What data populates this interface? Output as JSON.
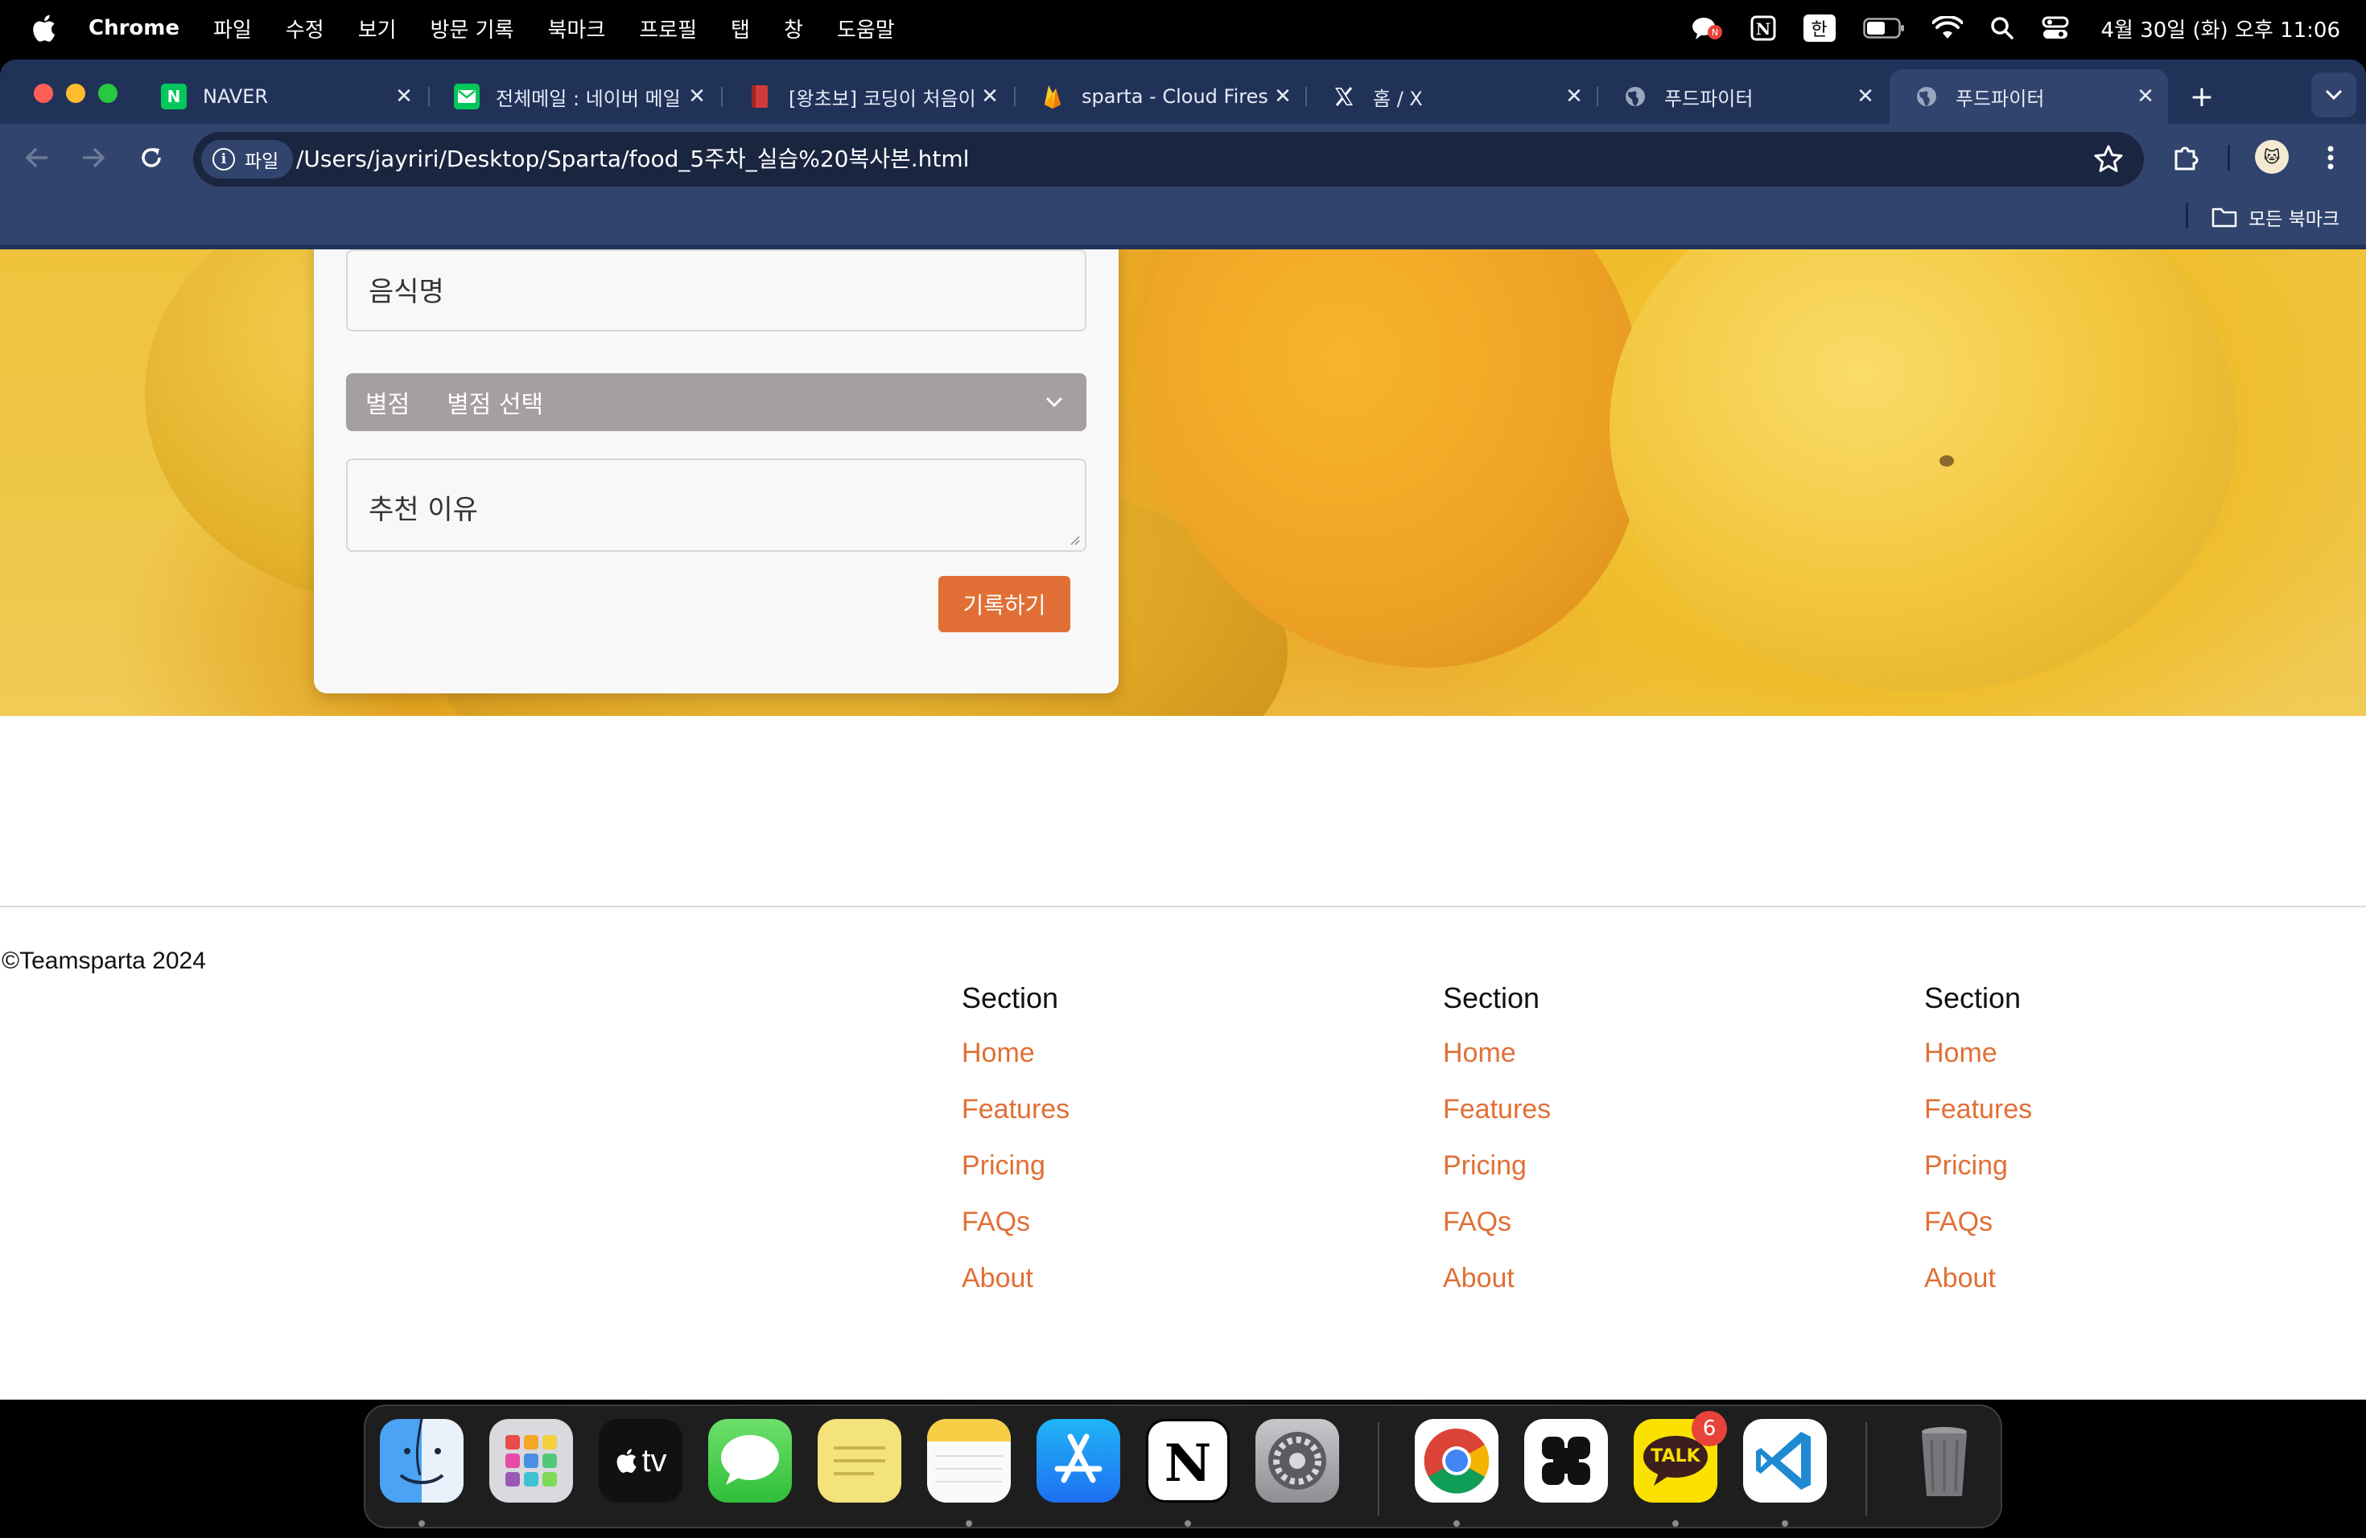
{
  "menubar": {
    "app_name": "Chrome",
    "menus": [
      "파일",
      "수정",
      "보기",
      "방문 기록",
      "북마크",
      "프로필",
      "탭",
      "창",
      "도움말"
    ],
    "input_method": "한",
    "clock": "4월 30일 (화) 오후 11:06"
  },
  "tabs": [
    {
      "title": "NAVER",
      "icon": "naver-icon"
    },
    {
      "title": "전체메일 : 네이버 메일",
      "icon": "naver-mail-icon"
    },
    {
      "title": "[왕초보] 코딩이 처음이",
      "icon": "book-icon"
    },
    {
      "title": "sparta - Cloud Fires",
      "icon": "firebase-icon"
    },
    {
      "title": "홈 / X",
      "icon": "x-icon"
    },
    {
      "title": "푸드파이터",
      "icon": "globe-icon"
    },
    {
      "title": "푸드파이터",
      "icon": "globe-icon",
      "active": true
    }
  ],
  "toolbar": {
    "site_chip": "파일",
    "url": "/Users/jayriri/Desktop/Sparta/food_5주차_실습%20복사본.html"
  },
  "bookmarks": {
    "all_bookmarks": "모든 북마크"
  },
  "form": {
    "name_placeholder": "음식명",
    "rating_label": "별점",
    "rating_selected": "별점 선택",
    "reason_placeholder": "추천 이유",
    "submit_label": "기록하기"
  },
  "footer": {
    "copyright": "©Teamsparta 2024",
    "columns": [
      {
        "heading": "Section",
        "links": [
          "Home",
          "Features",
          "Pricing",
          "FAQs",
          "About"
        ]
      },
      {
        "heading": "Section",
        "links": [
          "Home",
          "Features",
          "Pricing",
          "FAQs",
          "About"
        ]
      },
      {
        "heading": "Section",
        "links": [
          "Home",
          "Features",
          "Pricing",
          "FAQs",
          "About"
        ]
      }
    ]
  },
  "dock": {
    "apps": [
      "Finder",
      "Launchpad",
      "TV",
      "Messages",
      "Stickies",
      "Notes",
      "App Store",
      "Notion",
      "System Settings",
      "Chrome",
      "Capcut",
      "KakaoTalk",
      "Visual Studio Code",
      "Trash"
    ],
    "tv_label": "tv",
    "kakao_label": "TALK",
    "kakao_badge": "6"
  },
  "colors": {
    "accent": "#e16f35",
    "browser_frame": "#213259",
    "browser_toolbar": "#31446d",
    "rating_select_bg": "#a59f9f"
  }
}
